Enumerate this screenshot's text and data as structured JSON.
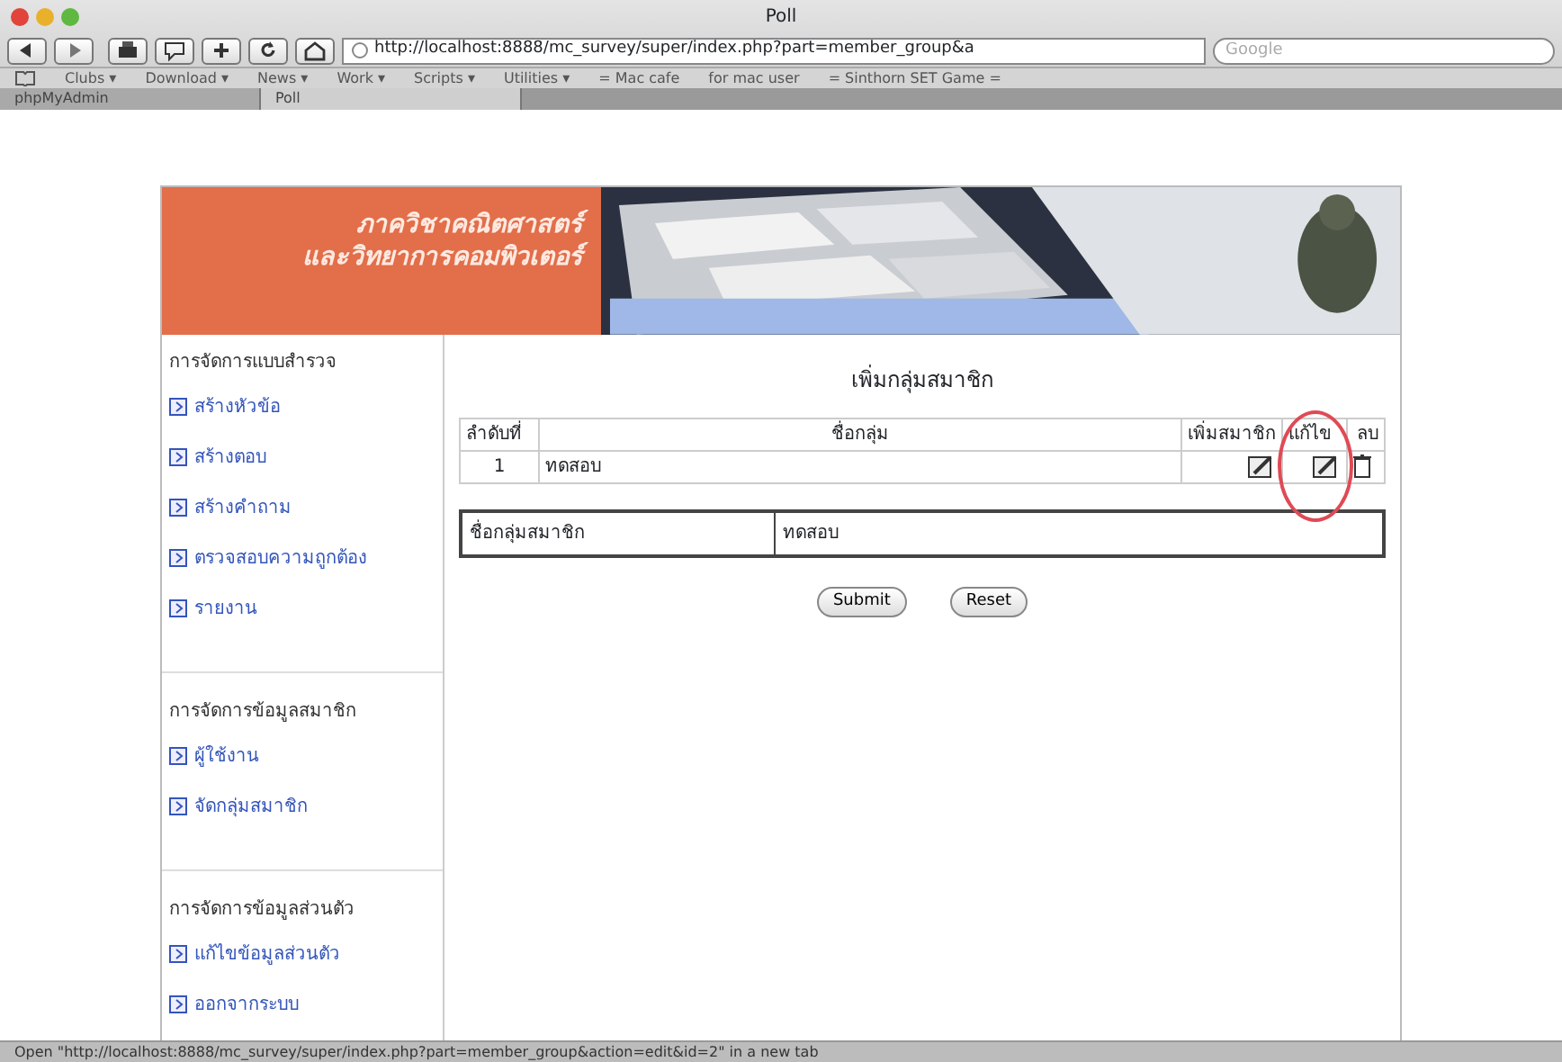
{
  "window": {
    "title": "Poll"
  },
  "toolbar": {
    "url": "http://localhost:8888/mc_survey/super/index.php?part=member_group&a",
    "search_placeholder": "Google"
  },
  "bookmarks": [
    "Clubs ▾",
    "Download ▾",
    "News ▾",
    "Work ▾",
    "Scripts ▾",
    "Utilities ▾",
    "= Mac cafe",
    "for mac user",
    "= Sinthorn SET Game ="
  ],
  "tabs": [
    {
      "label": "phpMyAdmin",
      "selected": false
    },
    {
      "label": "Poll",
      "selected": true
    }
  ],
  "page": {
    "banner": [
      "ภาควิชาคณิตศาสตร์",
      "และวิทยาการคอมพิวเตอร์"
    ],
    "sidebar": [
      {
        "heading": "การจัดการแบบสำรวจ",
        "items": [
          "สร้างหัวข้อ",
          "สร้างตอบ",
          "สร้างคำถาม",
          "ตรวจสอบความถูกต้อง",
          "รายงาน"
        ]
      },
      {
        "heading": "การจัดการข้อมูลสมาชิก",
        "items": [
          "ผู้ใช้งาน",
          "จัดกลุ่มสมาชิก"
        ]
      },
      {
        "heading": "การจัดการข้อมูลส่วนตัว",
        "items": [
          "แก้ไขข้อมูลส่วนตัว",
          "ออกจากระบบ"
        ]
      }
    ],
    "title": "เพิ่มกลุ่มสมาชิก",
    "table": {
      "columns": [
        {
          "label": "ลำดับที่",
          "kind": "text",
          "highlighted": false
        },
        {
          "label": "ชื่อกลุ่ม",
          "kind": "text",
          "highlighted": false
        },
        {
          "label": "เพิ่มสมาชิก",
          "kind": "edit",
          "highlighted": false
        },
        {
          "label": "แก้ไข",
          "kind": "edit",
          "highlighted": true
        },
        {
          "label": "ลบ",
          "kind": "delete",
          "highlighted": false
        }
      ],
      "rows": [
        [
          "1",
          "ทดสอบ"
        ]
      ]
    },
    "form": {
      "label": "ชื่อกลุ่มสมาชิก",
      "value": "ทดสอบ"
    },
    "buttons": [
      "Submit",
      "Reset"
    ]
  },
  "status_bar": "Open \"http://localhost:8888/mc_survey/super/index.php?part=member_group&action=edit&id=2\" in a new tab"
}
